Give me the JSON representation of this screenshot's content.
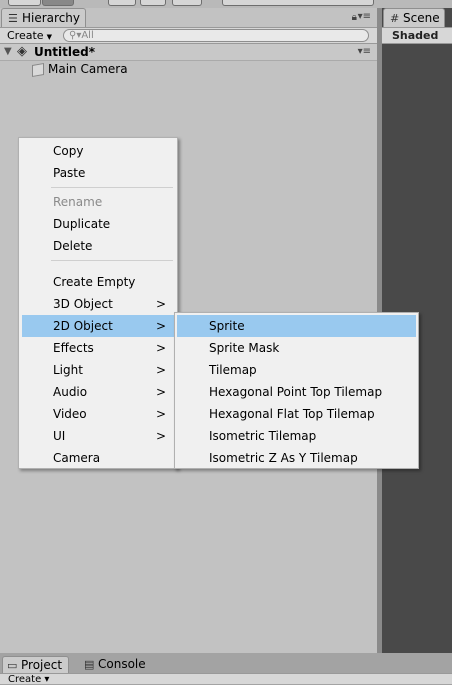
{
  "hierarchy": {
    "tab_label": "Hierarchy",
    "create_label": "Create",
    "search_placeholder": "All",
    "scene_name": "Untitled*",
    "objects": [
      "Main Camera"
    ]
  },
  "scene": {
    "tab_label": "Scene",
    "shading_mode": "Shaded"
  },
  "bottom_tabs": {
    "project_label": "Project",
    "console_label": "Console",
    "create_label": "Create"
  },
  "context_menu": {
    "items": [
      {
        "label": "Copy"
      },
      {
        "label": "Paste"
      },
      {
        "label": "Rename",
        "disabled": true
      },
      {
        "label": "Duplicate"
      },
      {
        "label": "Delete"
      },
      {
        "label": "Create Empty"
      },
      {
        "label": "3D Object",
        "submenu": true
      },
      {
        "label": "2D Object",
        "submenu": true,
        "highlighted": true
      },
      {
        "label": "Effects",
        "submenu": true
      },
      {
        "label": "Light",
        "submenu": true
      },
      {
        "label": "Audio",
        "submenu": true
      },
      {
        "label": "Video",
        "submenu": true
      },
      {
        "label": "UI",
        "submenu": true
      },
      {
        "label": "Camera"
      }
    ],
    "submenu_arrow": ">"
  },
  "submenu_2d": {
    "items": [
      {
        "label": "Sprite",
        "highlighted": true
      },
      {
        "label": "Sprite Mask"
      },
      {
        "label": "Tilemap"
      },
      {
        "label": "Hexagonal Point Top Tilemap"
      },
      {
        "label": "Hexagonal Flat Top Tilemap"
      },
      {
        "label": "Isometric Tilemap"
      },
      {
        "label": "Isometric Z As Y Tilemap"
      }
    ]
  },
  "colors": {
    "highlight": "#99c9ef",
    "menu_bg": "#f0f0f0",
    "panel_bg": "#c2c2c2",
    "scene_bg": "#494949"
  }
}
